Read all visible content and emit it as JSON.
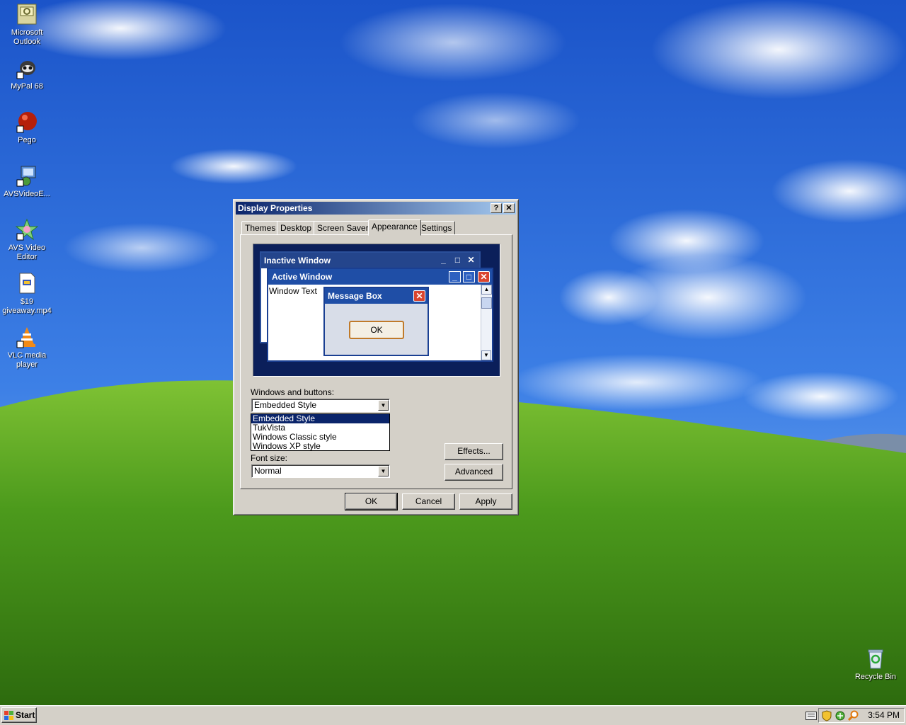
{
  "desktop": {
    "icons": [
      {
        "label": "Microsoft Outlook",
        "icon": "outlook-icon"
      },
      {
        "label": "MyPal 68",
        "icon": "mypal-icon"
      },
      {
        "label": "Pego",
        "icon": "pego-icon"
      },
      {
        "label": "AVSVideoE...",
        "icon": "avs-installer-icon"
      },
      {
        "label": "AVS Video Editor",
        "icon": "avs-editor-icon"
      },
      {
        "label": "$19 giveaway.mp4",
        "icon": "video-file-icon"
      },
      {
        "label": "VLC media player",
        "icon": "vlc-icon"
      }
    ],
    "recycle_bin": {
      "label": "Recycle Bin",
      "icon": "recycle-bin-icon"
    }
  },
  "dialog": {
    "title": "Display Properties",
    "help_glyph": "?",
    "close_glyph": "✕",
    "tabs": [
      "Themes",
      "Desktop",
      "Screen Saver",
      "Appearance",
      "Settings"
    ],
    "active_tab": "Appearance",
    "preview": {
      "inactive_title": "Inactive Window",
      "active_title": "Active Window",
      "window_text": "Window Text",
      "message_box_title": "Message Box",
      "ok_label": "OK"
    },
    "windows_buttons_label": "Windows and buttons:",
    "windows_buttons_value": "Embedded Style",
    "dropdown_options": [
      "Embedded Style",
      "TukVista",
      "Windows Classic style",
      "Windows XP style"
    ],
    "dropdown_selected_index": 0,
    "font_size_label": "Font size:",
    "font_size_value": "Normal",
    "effects_label": "Effects...",
    "advanced_label": "Advanced",
    "ok_label": "OK",
    "cancel_label": "Cancel",
    "apply_label": "Apply"
  },
  "taskbar": {
    "start_label": "Start",
    "clock": "3:54 PM",
    "tray_icons": [
      "keyboard-icon",
      "security-shield-icon",
      "network-icon",
      "search-magnifier-icon"
    ]
  },
  "colors": {
    "titlebar_start": "#0a246a",
    "titlebar_end": "#a6caf0",
    "selection": "#0a246a",
    "dialog_face": "#d4d0c8",
    "preview_bg": "#0b1f5a"
  }
}
